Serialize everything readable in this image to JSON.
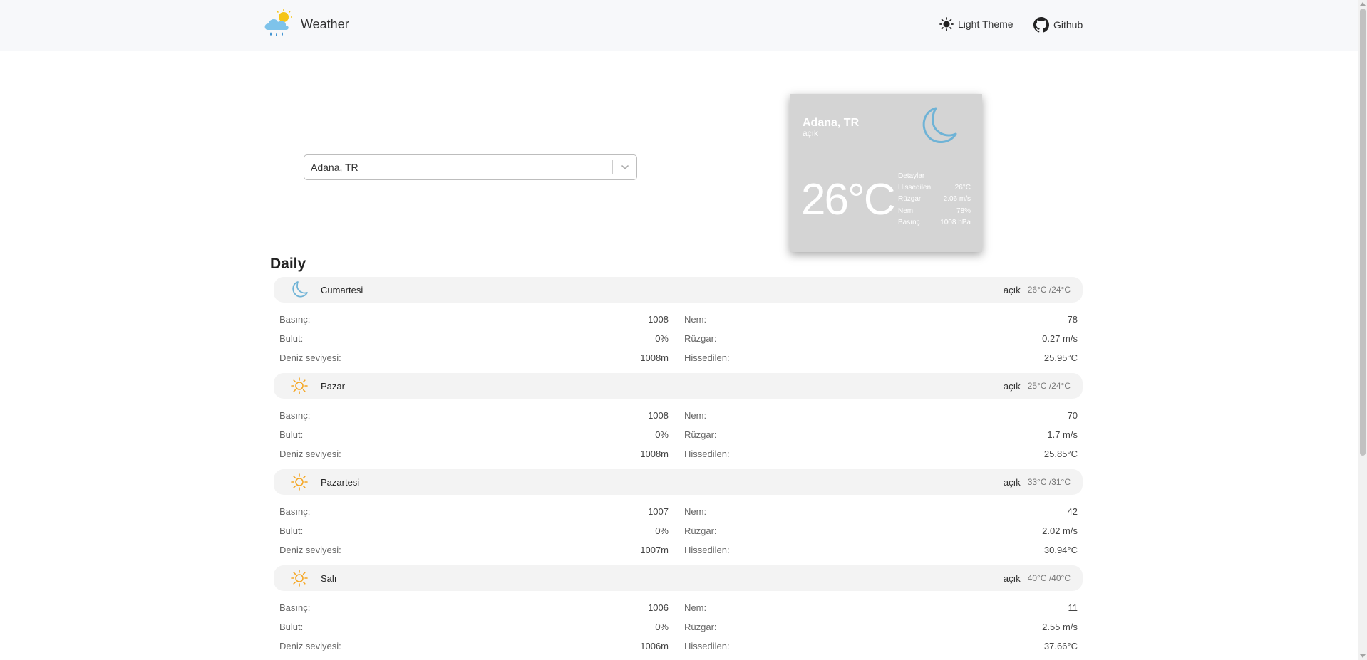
{
  "nav": {
    "brand": "Weather",
    "theme_label": "Light Theme",
    "github_label": "Github"
  },
  "search": {
    "selected": "Adana, TR"
  },
  "current": {
    "city": "Adana, TR",
    "description": "açık",
    "temp": "26°C",
    "details_title": "Detaylar",
    "details": [
      {
        "label": "Hissedilen",
        "value": "26°C"
      },
      {
        "label": "Rüzgar",
        "value": "2.06 m/s"
      },
      {
        "label": "Nem",
        "value": "78%"
      },
      {
        "label": "Basınç",
        "value": "1008 hPa"
      }
    ]
  },
  "daily": {
    "title": "Daily",
    "days": [
      {
        "name": "Cumartesi",
        "icon": "moon-icon",
        "description": "açık",
        "temps": "26°C /24°C",
        "rows": [
          [
            "Basınç:",
            "1008",
            "Nem:",
            "78"
          ],
          [
            "Bulut:",
            "0%",
            "Rüzgar:",
            "0.27 m/s"
          ],
          [
            "Deniz seviyesi:",
            "1008m",
            "Hissedilen:",
            "25.95°C"
          ]
        ]
      },
      {
        "name": "Pazar",
        "icon": "sun-icon",
        "description": "açık",
        "temps": "25°C /24°C",
        "rows": [
          [
            "Basınç:",
            "1008",
            "Nem:",
            "70"
          ],
          [
            "Bulut:",
            "0%",
            "Rüzgar:",
            "1.7 m/s"
          ],
          [
            "Deniz seviyesi:",
            "1008m",
            "Hissedilen:",
            "25.85°C"
          ]
        ]
      },
      {
        "name": "Pazartesi",
        "icon": "sun-icon",
        "description": "açık",
        "temps": "33°C /31°C",
        "rows": [
          [
            "Basınç:",
            "1007",
            "Nem:",
            "42"
          ],
          [
            "Bulut:",
            "0%",
            "Rüzgar:",
            "2.02 m/s"
          ],
          [
            "Deniz seviyesi:",
            "1007m",
            "Hissedilen:",
            "30.94°C"
          ]
        ]
      },
      {
        "name": "Salı",
        "icon": "sun-icon",
        "description": "açık",
        "temps": "40°C /40°C",
        "rows": [
          [
            "Basınç:",
            "1006",
            "Nem:",
            "11"
          ],
          [
            "Bulut:",
            "0%",
            "Rüzgar:",
            "2.55 m/s"
          ],
          [
            "Deniz seviyesi:",
            "1006m",
            "Hissedilen:",
            "37.66°C"
          ]
        ]
      }
    ]
  },
  "colors": {
    "moon": "#6fb3d6",
    "sun": "#f5a623",
    "card_bg": "#d4d4d4",
    "navbar_bg": "#f7f8fa"
  }
}
